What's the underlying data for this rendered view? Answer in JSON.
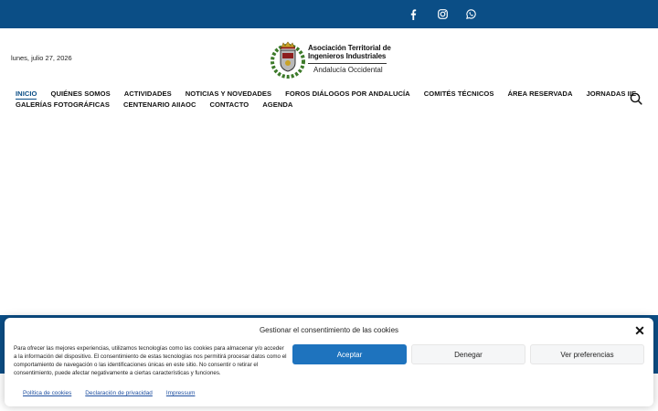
{
  "top_bar": {
    "socials": [
      {
        "icon": "facebook-icon"
      },
      {
        "icon": "instagram-icon"
      },
      {
        "icon": "whatsapp-icon"
      }
    ],
    "color": "#0b4e86"
  },
  "header": {
    "date": "lunes, julio 27, 2026",
    "logo": {
      "line1": "Asociación Territorial de",
      "line2": "Ingenieros Industriales",
      "line3": "Andalucía Occidental"
    }
  },
  "nav": {
    "row1": [
      "INICIO",
      "QUIÉNES SOMOS",
      "ACTIVIDADES",
      "NOTICIAS Y NOVEDADES",
      "FOROS DIÁLOGOS POR ANDALUCÍA",
      "COMITÉS TÉCNICOS",
      "ÁREA RESERVADA",
      "JORNADAS IIE"
    ],
    "row2": [
      "GALERÍAS FOTOGRÁFICAS",
      "CENTENARIO AIIAOC",
      "CONTACTO",
      "AGENDA"
    ],
    "active": "INICIO",
    "search_icon": "search-icon"
  },
  "cookie_banner": {
    "title": "Gestionar el consentimiento de las cookies",
    "text": "Para ofrecer las mejores experiencias, utilizamos tecnologías como las cookies para almacenar y/o acceder a la información del dispositivo. El consentimiento de estas tecnologías nos permitirá procesar datos como el comportamiento de navegación o las identificaciones únicas en este sitio. No consentir o retirar el consentimiento, puede afectar negativamente a ciertas características y funciones.",
    "accept_label": "Aceptar",
    "deny_label": "Denegar",
    "prefs_label": "Ver preferencias",
    "links": [
      "Política de cookies",
      "Declaración de privacidad",
      "Impressum"
    ],
    "accent": "#1e73be"
  }
}
